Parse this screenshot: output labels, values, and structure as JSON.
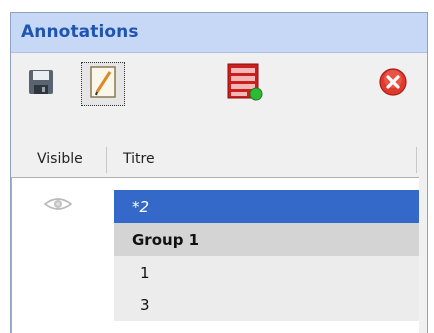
{
  "panel": {
    "title": "Annotations"
  },
  "toolbar": {
    "save_icon": "floppy-disk-icon",
    "edit_icon": "pencil-edit-icon",
    "layers_icon": "layer-list-add-icon",
    "close_icon": "close-circle-icon"
  },
  "columns": {
    "visible": "Visible",
    "titre": "Titre"
  },
  "rows": [
    {
      "title": "*2",
      "selected": true,
      "visible_icon": "eye-icon",
      "type": "annotation"
    },
    {
      "title": "Group 1",
      "selected": false,
      "type": "group"
    },
    {
      "title": "1",
      "selected": false,
      "type": "annotation"
    },
    {
      "title": "3",
      "selected": false,
      "type": "annotation"
    }
  ],
  "colors": {
    "title_bar": "#c7d7f6",
    "title_text": "#1f54b0",
    "selection": "#3569c9",
    "group_row": "#d4d4d4"
  }
}
